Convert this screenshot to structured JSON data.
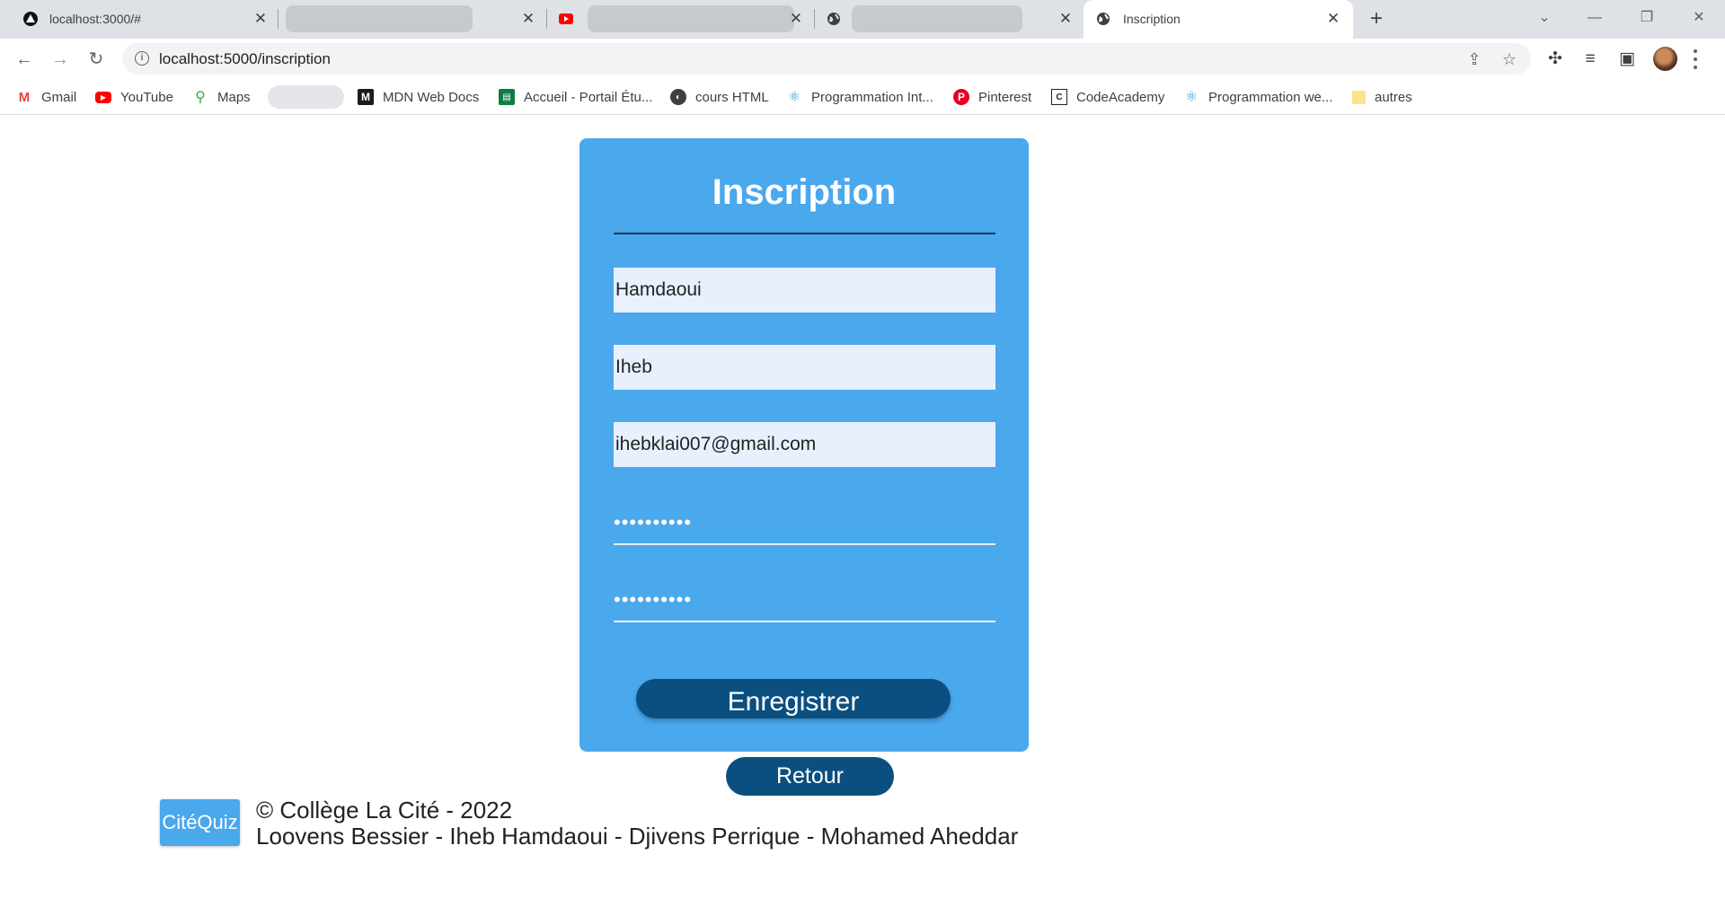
{
  "browser": {
    "tabs": [
      {
        "title": "localhost:3000/#",
        "icon": "app-icon"
      },
      {
        "title": "",
        "icon": "",
        "blurred": true
      },
      {
        "title": "",
        "icon": "youtube-icon",
        "blurred": true
      },
      {
        "title": "",
        "icon": "globe-icon",
        "blurred": true
      },
      {
        "title": "Inscription",
        "icon": "globe-icon",
        "active": true
      }
    ],
    "url": "localhost:5000/inscription",
    "bookmarks": [
      {
        "label": "Gmail",
        "icon": "gmail-icon"
      },
      {
        "label": "YouTube",
        "icon": "youtube-icon"
      },
      {
        "label": "Maps",
        "icon": "maps-icon"
      },
      {
        "label": "MDN Web Docs",
        "icon": "mdn-icon"
      },
      {
        "label": "Accueil - Portail Étu...",
        "icon": "portal-icon"
      },
      {
        "label": "cours HTML",
        "icon": "globe-icon"
      },
      {
        "label": "Programmation Int...",
        "icon": "react-icon"
      },
      {
        "label": "Pinterest",
        "icon": "pinterest-icon"
      },
      {
        "label": "CodeAcademy",
        "icon": "codeacademy-icon"
      },
      {
        "label": "Programmation we...",
        "icon": "react-icon"
      },
      {
        "label": "autres",
        "icon": "folder-icon"
      }
    ]
  },
  "form": {
    "title": "Inscription",
    "nom": "Hamdaoui",
    "prenom": "Iheb",
    "email": "ihebklai007@gmail.com",
    "password_mask": "••••••••••",
    "confirm_mask": "••••••••••",
    "submit_label": "Enregistrer",
    "back_label": "Retour"
  },
  "footer": {
    "logo": "CitéQuiz",
    "copyright": "© Collège La Cité - 2022",
    "authors": "Loovens Bessier - Iheb Hamdaoui - Djivens Perrique - Mohamed Aheddar"
  },
  "colors": {
    "card": "#4aa8ec",
    "button": "#0b4f80",
    "input_bg": "#e8f0fe"
  }
}
